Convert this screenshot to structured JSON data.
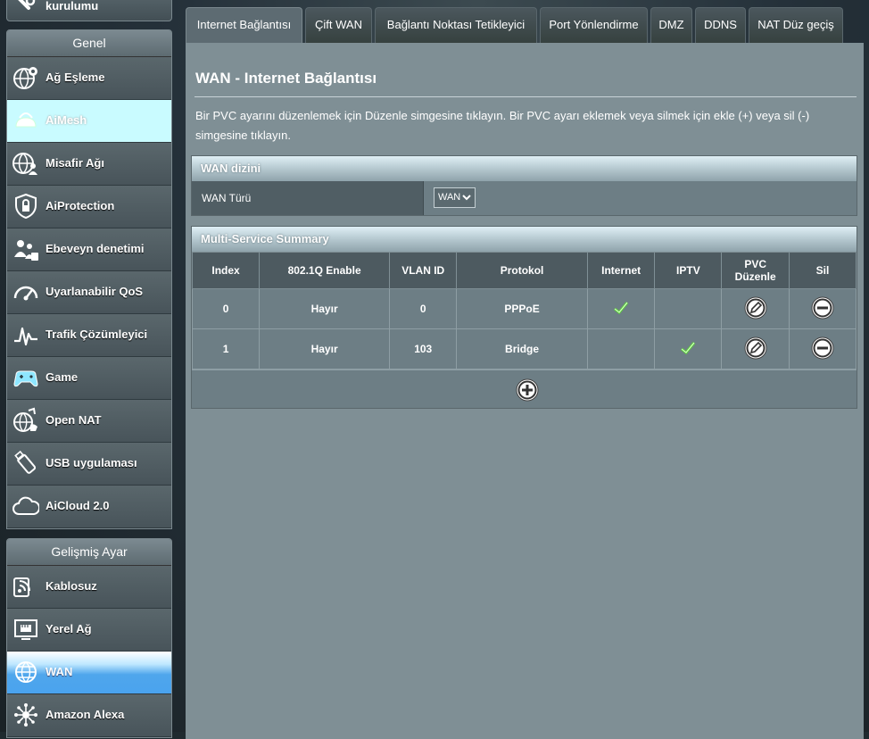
{
  "sidebar": {
    "top_stub": {
      "label": "kurulumu",
      "icon": "wrench-icon"
    },
    "group_general": {
      "title": "Genel",
      "items": [
        {
          "label": "Ağ Eşleme",
          "icon": "network-map-icon"
        },
        {
          "label": "AiMesh",
          "icon": "mesh-icon",
          "state": "highlighted"
        },
        {
          "label": "Misafir Ağı",
          "icon": "guest-network-icon"
        },
        {
          "label": "AiProtection",
          "icon": "shield-icon"
        },
        {
          "label": "Ebeveyn denetimi",
          "icon": "parental-control-icon"
        },
        {
          "label": "Uyarlanabilir QoS",
          "icon": "speedometer-icon"
        },
        {
          "label": "Trafik Çözümleyici",
          "icon": "traffic-analyzer-icon"
        },
        {
          "label": "Game",
          "icon": "gamepad-icon"
        },
        {
          "label": "Open NAT",
          "icon": "open-nat-icon"
        },
        {
          "label": "USB uygulaması",
          "icon": "usb-icon"
        },
        {
          "label": "AiCloud 2.0",
          "icon": "cloud-icon"
        }
      ]
    },
    "group_advanced": {
      "title": "Gelişmiş Ayar",
      "items": [
        {
          "label": "Kablosuz",
          "icon": "wireless-icon"
        },
        {
          "label": "Yerel Ağ",
          "icon": "lan-icon"
        },
        {
          "label": "WAN",
          "icon": "globe-icon",
          "state": "selected"
        },
        {
          "label": "Amazon Alexa",
          "icon": "alexa-icon"
        }
      ]
    }
  },
  "tabs": [
    {
      "label": "Internet Bağlantısı",
      "active": true
    },
    {
      "label": "Çift WAN"
    },
    {
      "label": "Bağlantı Noktası Tetikleyici"
    },
    {
      "label": "Port Yönlendirme"
    },
    {
      "label": "DMZ"
    },
    {
      "label": "DDNS"
    },
    {
      "label": "NAT Düz geçiş"
    }
  ],
  "main": {
    "title": "WAN - Internet Bağlantısı",
    "description": "Bir PVC ayarını düzenlemek için Düzenle simgesine tıklayın. Bir PVC ayarı eklemek veya silmek için ekle (+) veya sil (-) simgesine tıklayın.",
    "wan_index": {
      "header": "WAN dizini",
      "wan_type_label": "WAN Türü",
      "wan_type_value": "WAN"
    },
    "summary": {
      "header": "Multi-Service Summary",
      "columns": [
        "Index",
        "802.1Q Enable",
        "VLAN ID",
        "Protokol",
        "Internet",
        "IPTV",
        "PVC Düzenle",
        "Sil"
      ],
      "rows": [
        {
          "index": "0",
          "enable": "Hayır",
          "vlan": "0",
          "protocol": "PPPoE",
          "internet": true,
          "iptv": false
        },
        {
          "index": "1",
          "enable": "Hayır",
          "vlan": "103",
          "protocol": "Bridge",
          "internet": false,
          "iptv": true
        }
      ]
    }
  },
  "colors": {
    "content_bg": "#7f8f95",
    "active_blue": "#4aa3ee",
    "active_light": "#c9fbff",
    "check_green": "#5fd03a"
  }
}
